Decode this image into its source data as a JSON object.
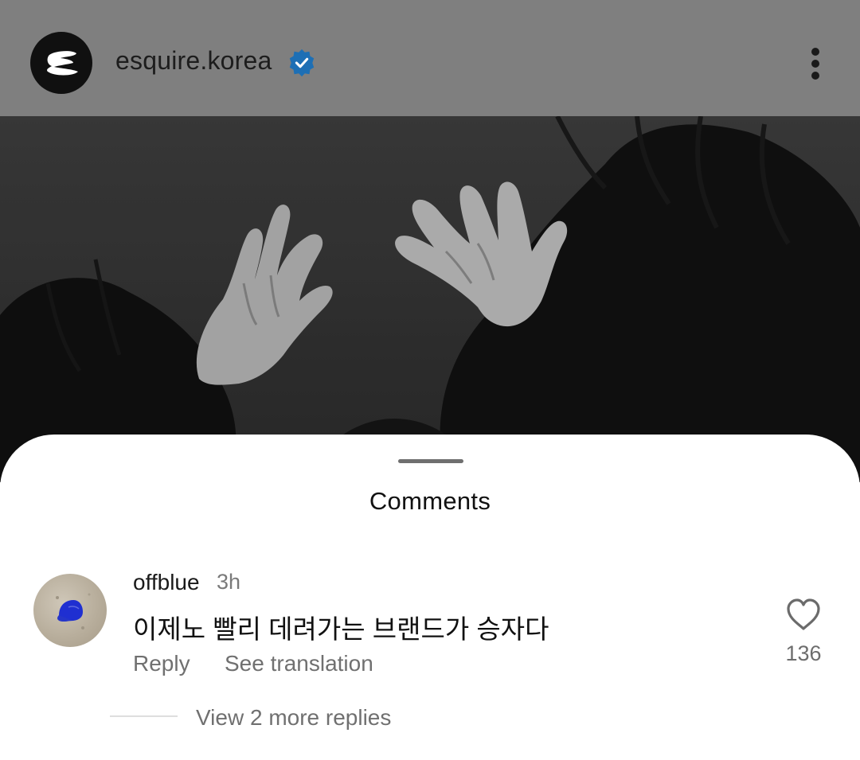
{
  "post_header": {
    "username": "esquire.korea",
    "avatar_icon": "esquire-e-logo-icon",
    "verified_icon": "verified-badge-icon",
    "verified_color": "#1d6fb5",
    "more_icon": "vertical-dots-icon"
  },
  "comments_sheet": {
    "title": "Comments",
    "comments": [
      {
        "username": "offblue",
        "time": "3h",
        "text": "이제노 빨리 데려가는 브랜드가 승자다",
        "reply_label": "Reply",
        "translate_label": "See translation",
        "like_count": "136",
        "view_replies_label": "View 2 more replies"
      }
    ]
  }
}
